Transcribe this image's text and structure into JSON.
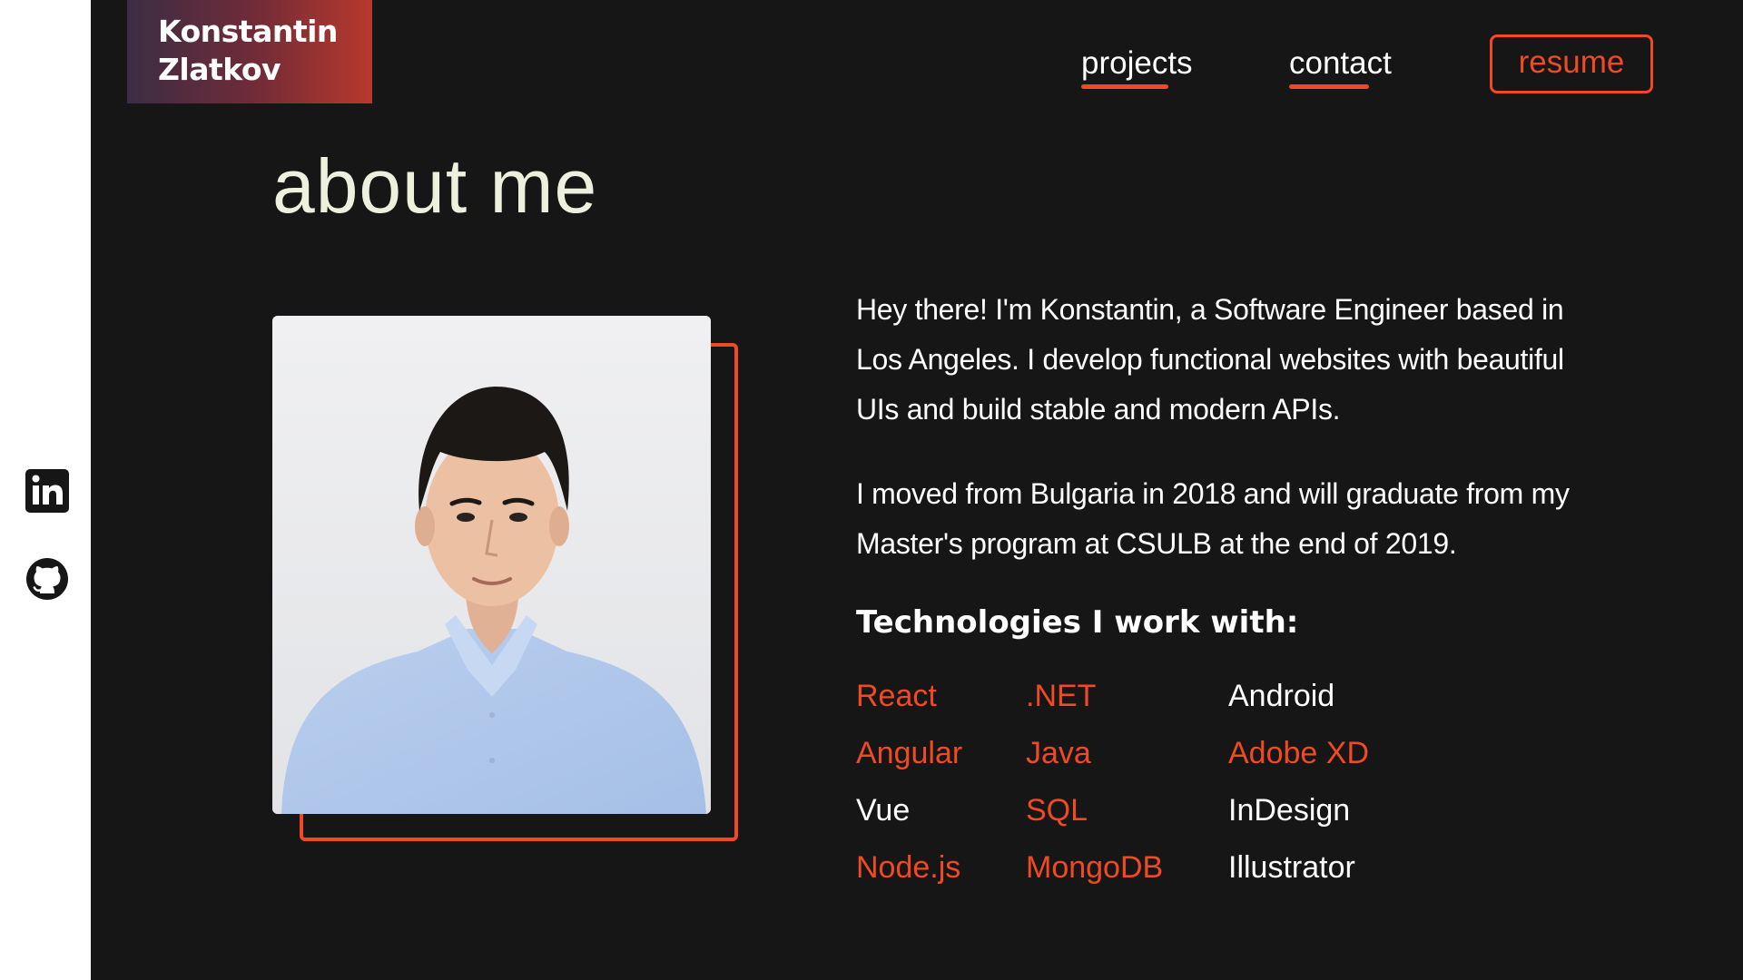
{
  "logo": {
    "line1": "Konstantin",
    "line2": "Zlatkov"
  },
  "nav": {
    "projects": "projects",
    "contact": "contact",
    "resume": "resume"
  },
  "page_title": "about me",
  "bio": {
    "paragraph1": "Hey there! I'm Konstantin, a Software Engineer based in Los Angeles. I develop functional websites with beautiful UIs and build stable and modern APIs.",
    "paragraph2": "I moved from Bulgaria in 2018 and will graduate  from my Master's program at CSULB at the end of 2019."
  },
  "technologies": {
    "heading": "Technologies I work with:",
    "col1": [
      {
        "name": "React",
        "highlight": true
      },
      {
        "name": "Angular",
        "highlight": true
      },
      {
        "name": "Vue",
        "highlight": false
      },
      {
        "name": "Node.js",
        "highlight": true
      }
    ],
    "col2": [
      {
        "name": ".NET",
        "highlight": true
      },
      {
        "name": "Java",
        "highlight": true
      },
      {
        "name": "SQL",
        "highlight": true
      },
      {
        "name": "MongoDB",
        "highlight": true
      }
    ],
    "col3": [
      {
        "name": "Android",
        "highlight": false
      },
      {
        "name": "Adobe XD",
        "highlight": true
      },
      {
        "name": "InDesign",
        "highlight": false
      },
      {
        "name": "Illustrator",
        "highlight": false
      }
    ]
  },
  "social": {
    "linkedin_icon": "linkedin-icon",
    "github_icon": "github-icon"
  },
  "colors": {
    "accent": "#f04a22",
    "background": "#161616",
    "title": "#eef0de",
    "text": "#ffffff"
  }
}
